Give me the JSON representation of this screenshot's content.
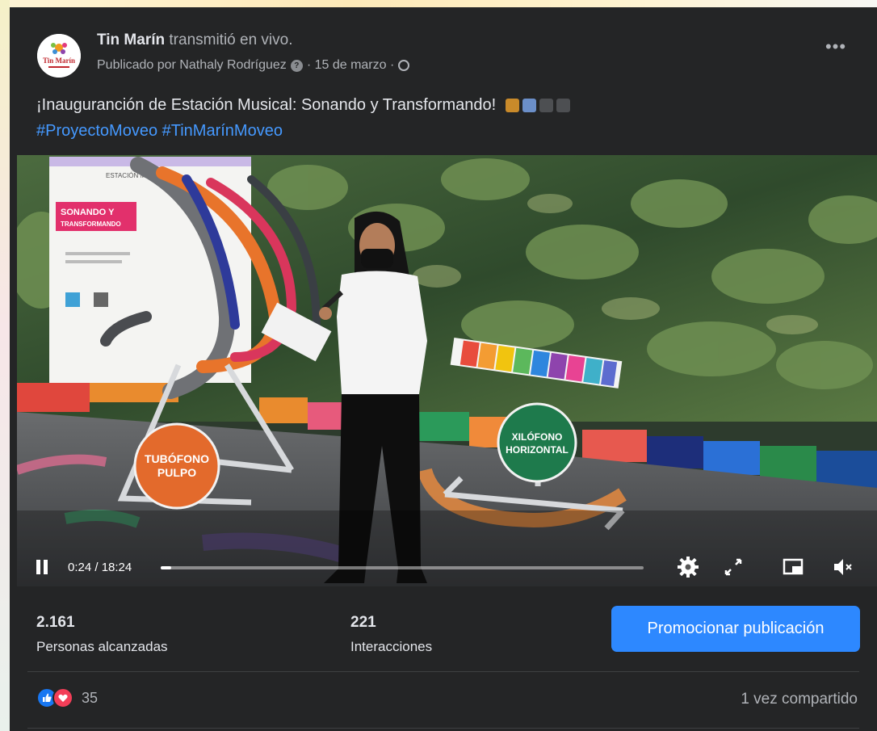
{
  "post": {
    "author": "Tin Marín",
    "action": "transmitió en vivo.",
    "published_by": "Publicado por Nathaly Rodríguez",
    "date": "· 15 de marzo ·",
    "text": "¡Inauguranción de Estación Musical: Sonando y Transformando!",
    "hashtags": [
      "#ProyectoMoveo",
      "#TinMarínMoveo"
    ],
    "logo_text": "Tin Marín"
  },
  "video": {
    "time": "0:24 / 18:24",
    "progress": 0.022,
    "signs": {
      "left_line1": "TUBÓFONO",
      "left_line2": "PULPO",
      "right_line1": "XILÓFONO",
      "right_line2": "HORIZONTAL",
      "banner_line1": "SONANDO Y",
      "banner_line2": "TRANSFORMANDO",
      "banner_top": "ESTACIÓN MUSICAL"
    }
  },
  "stats": {
    "reach_value": "2.161",
    "reach_label": "Personas alcanzadas",
    "interactions_value": "221",
    "interactions_label": "Interacciones",
    "promote_label": "Promocionar publicación"
  },
  "footer": {
    "reaction_count": "35",
    "shares": "1 vez compartido"
  },
  "colors": {
    "card_bg": "#242526",
    "link": "#4599ff",
    "promote_button": "#2d88ff"
  }
}
